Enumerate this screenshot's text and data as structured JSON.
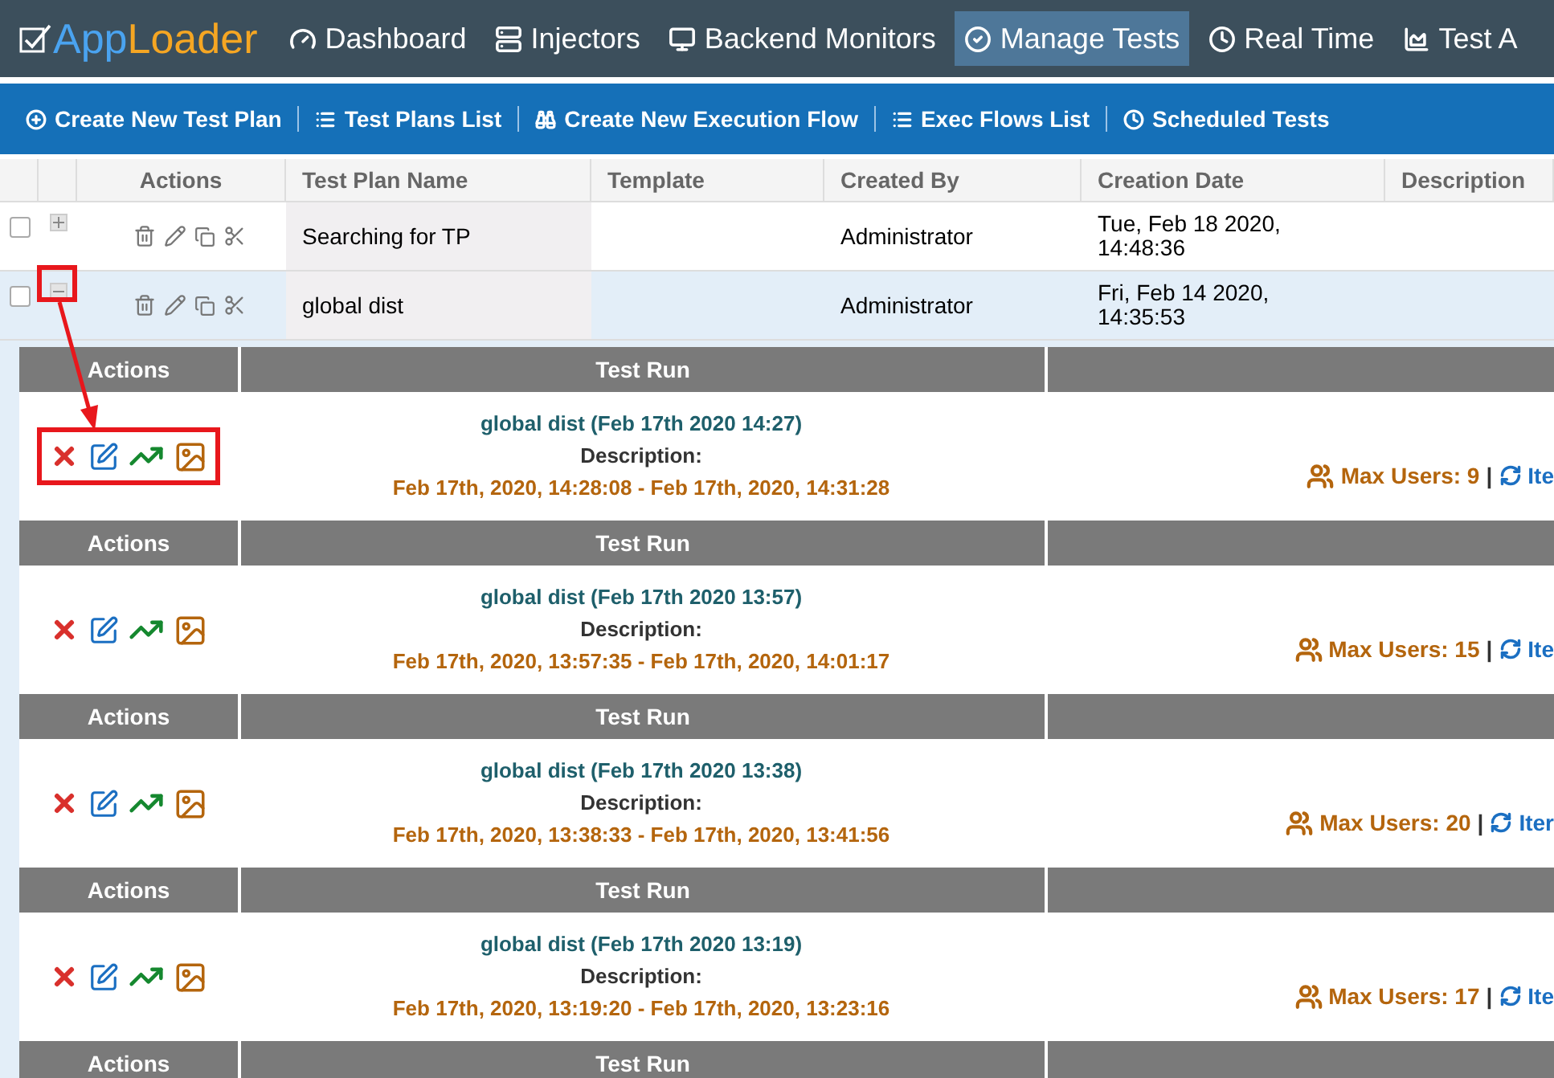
{
  "brand": {
    "part1": "App",
    "part2": "Loader"
  },
  "nav": [
    {
      "label": "Dashboard",
      "selected": false
    },
    {
      "label": "Injectors",
      "selected": false
    },
    {
      "label": "Backend Monitors",
      "selected": false
    },
    {
      "label": "Manage Tests",
      "selected": true
    },
    {
      "label": "Real Time",
      "selected": false
    },
    {
      "label": "Test A",
      "selected": false
    }
  ],
  "subnav": [
    {
      "label": "Create New Test Plan"
    },
    {
      "label": "Test Plans List"
    },
    {
      "label": "Create New Execution Flow"
    },
    {
      "label": "Exec Flows List"
    },
    {
      "label": "Scheduled Tests"
    }
  ],
  "table": {
    "columns": [
      "Actions",
      "Test Plan Name",
      "Template",
      "Created By",
      "Creation Date",
      "Description"
    ],
    "rows": [
      {
        "checked": false,
        "expanded": false,
        "name": "Searching for TP",
        "created_by": "Administrator",
        "date_line1": "Tue, Feb 18 2020,",
        "date_line2": "14:48:36"
      },
      {
        "checked": false,
        "expanded": true,
        "name": "global dist",
        "created_by": "Administrator",
        "date_line1": "Fri, Feb 14 2020,",
        "date_line2": "14:35:53"
      }
    ]
  },
  "runs": [
    {
      "header": {
        "actions": "Actions",
        "test_run": "Test Run"
      },
      "title": "global dist (Feb 17th 2020 14:27)",
      "description_label": "Description:",
      "period": "Feb 17th, 2020, 14:28:08 - Feb 17th, 2020, 14:31:28",
      "max_users": "Max Users: 9",
      "separator": "|",
      "iterations": "Ite",
      "highlighted": true
    },
    {
      "header": {
        "actions": "Actions",
        "test_run": "Test Run"
      },
      "title": "global dist (Feb 17th 2020 13:57)",
      "description_label": "Description:",
      "period": "Feb 17th, 2020, 13:57:35 - Feb 17th, 2020, 14:01:17",
      "max_users": "Max Users: 15",
      "separator": "|",
      "iterations": "Ite",
      "highlighted": false
    },
    {
      "header": {
        "actions": "Actions",
        "test_run": "Test Run"
      },
      "title": "global dist (Feb 17th 2020 13:38)",
      "description_label": "Description:",
      "period": "Feb 17th, 2020, 13:38:33 - Feb 17th, 2020, 13:41:56",
      "max_users": "Max Users: 20",
      "separator": "|",
      "iterations": "Iter",
      "highlighted": false
    },
    {
      "header": {
        "actions": "Actions",
        "test_run": "Test Run"
      },
      "title": "global dist (Feb 17th 2020 13:19)",
      "description_label": "Description:",
      "period": "Feb 17th, 2020, 13:19:20 - Feb 17th, 2020, 13:23:16",
      "max_users": "Max Users: 17",
      "separator": "|",
      "iterations": "Ite",
      "highlighted": false
    }
  ],
  "last_header": {
    "actions": "Actions",
    "test_run": "Test Run"
  }
}
